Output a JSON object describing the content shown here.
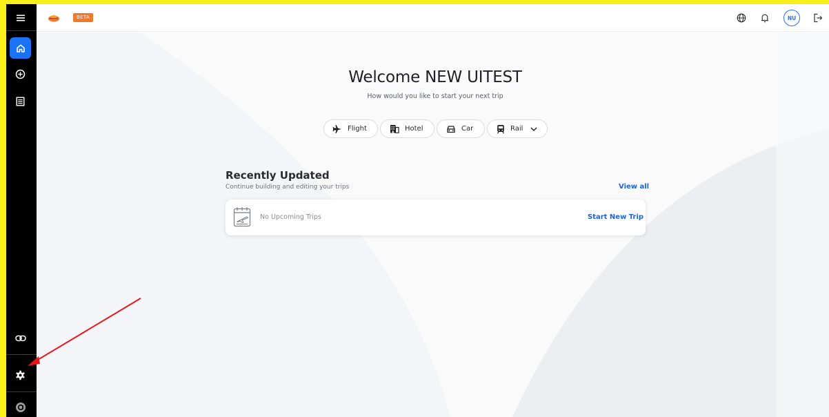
{
  "header": {
    "beta_label": "BETA",
    "avatar_initials": "NU"
  },
  "welcome": {
    "title": "Welcome NEW UITEST",
    "subtitle": "How would you like to start your next trip"
  },
  "modes": [
    {
      "label": "Flight"
    },
    {
      "label": "Hotel"
    },
    {
      "label": "Car"
    },
    {
      "label": "Rail"
    }
  ],
  "recent": {
    "title": "Recently Updated",
    "subtitle": "Continue building and editing your trips",
    "view_all": "View all",
    "empty_text": "No Upcoming Trips",
    "start_new": "Start New Trip"
  },
  "sidebar": {
    "items": [
      {
        "icon": "menu-icon"
      },
      {
        "icon": "home-icon",
        "active": true
      },
      {
        "icon": "add-circle-icon"
      },
      {
        "icon": "list-icon"
      },
      {
        "icon": "link-icon"
      },
      {
        "icon": "settings-icon"
      },
      {
        "icon": "user-profile-icon"
      }
    ]
  },
  "colors": {
    "accent": "#1a73f5",
    "link": "#1e63d6",
    "sidebar_bg": "#000000",
    "beta_badge": "#f07a2b",
    "frame": "#f9f01a",
    "annotation_arrow": "#e8161b"
  }
}
